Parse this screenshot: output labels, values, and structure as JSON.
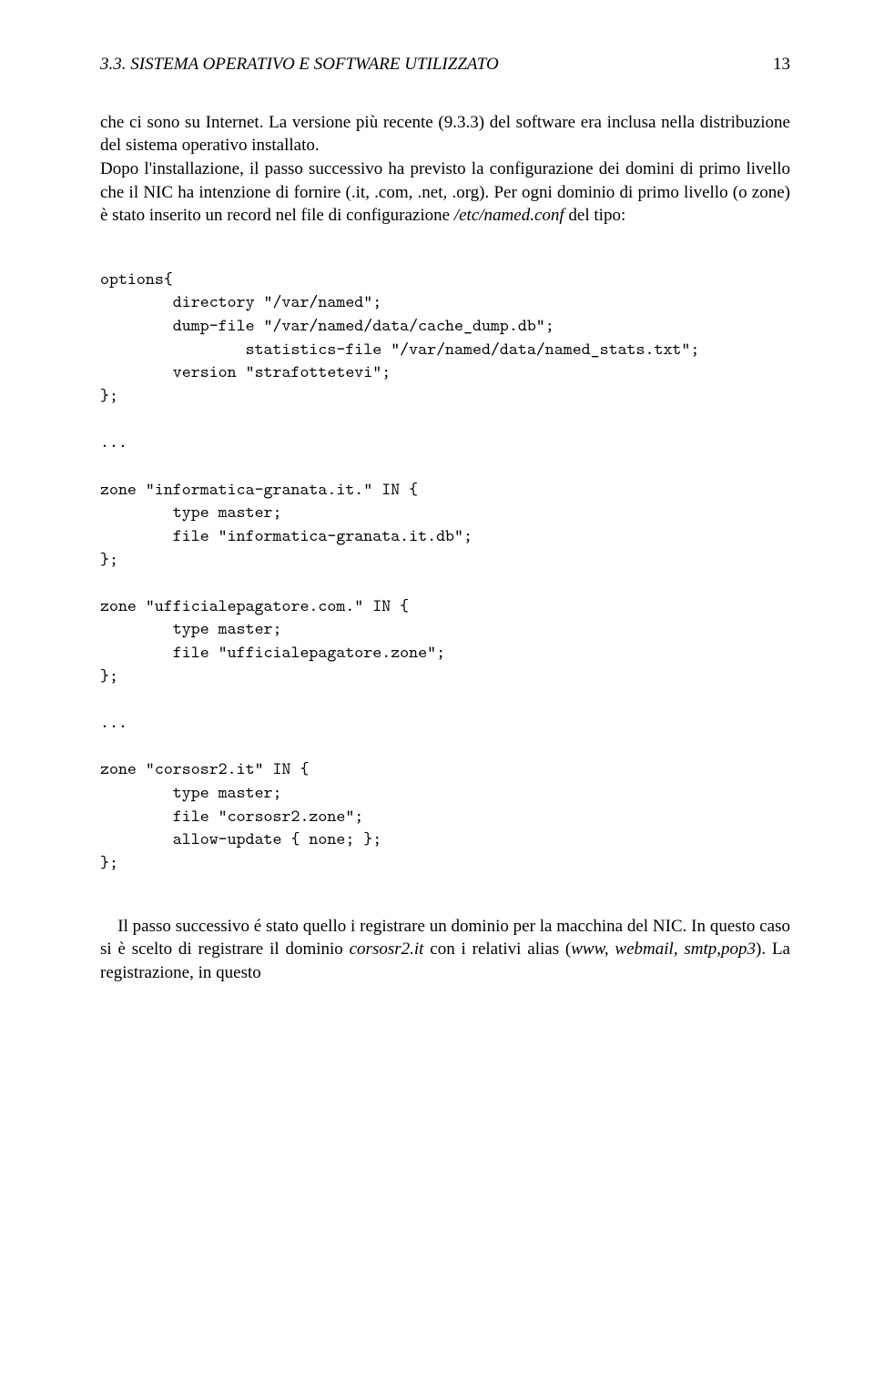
{
  "header": {
    "section": "3.3. SISTEMA OPERATIVO E SOFTWARE UTILIZZATO",
    "page_number": "13"
  },
  "para1": {
    "t1": "che ci sono su Internet. La versione più recente (9.3.3) del software era inclusa nella distribuzione del sistema operativo installato.",
    "t2": "Dopo l'installazione, il passo successivo ha previsto la configurazione dei domini di primo livello che il NIC ha intenzione di fornire (.it, .com, .net, .org). Per ogni dominio di primo livello (o zone) è stato inserito un record nel file di configurazione ",
    "conf_path": "/etc/named.conf",
    "t3": " del tipo:"
  },
  "code": "options{\n        directory \"/var/named\";\n        dump-file \"/var/named/data/cache_dump.db\";\n                statistics-file \"/var/named/data/named_stats.txt\";\n        version \"strafottetevi\";\n};\n\n...\n\nzone \"informatica-granata.it.\" IN {\n        type master;\n        file \"informatica-granata.it.db\";\n};\n\nzone \"ufficialepagatore.com.\" IN {\n        type master;\n        file \"ufficialepagatore.zone\";\n};\n\n...\n\nzone \"corsosr2.it\" IN {\n        type master;\n        file \"corsosr2.zone\";\n        allow-update { none; };\n};",
  "para2": {
    "t1": "Il passo successivo é stato quello i registrare un dominio per la macchina del NIC. In questo caso si è scelto di registrare il dominio ",
    "domain": "corsosr2.it",
    "t2": " con i relativi alias (",
    "aliases": "www, webmail, smtp,pop3",
    "t3": "). La registrazione, in questo"
  }
}
